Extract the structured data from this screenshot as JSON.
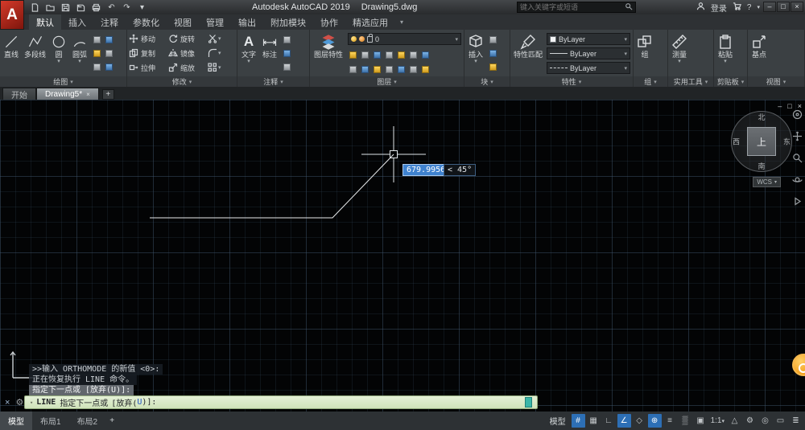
{
  "title_bar": {
    "logo_letter": "A",
    "app_title": "Autodesk AutoCAD 2019",
    "doc_title": "Drawing5.dwg",
    "search_placeholder": "键入关键字或短语",
    "login_label": "登录"
  },
  "ribbon": {
    "tabs": [
      "默认",
      "插入",
      "注释",
      "参数化",
      "视图",
      "管理",
      "输出",
      "附加模块",
      "协作",
      "精选应用"
    ],
    "panels": {
      "draw": {
        "label": "绘图",
        "tools": [
          "直线",
          "多段线",
          "圆",
          "圆弧"
        ]
      },
      "modify": {
        "label": "修改",
        "tools": [
          "移动",
          "旋转",
          "复制",
          "镜像",
          "拉伸",
          "缩放"
        ]
      },
      "annotate": {
        "label": "注释",
        "icon_letter": "A",
        "tools": [
          "文字",
          "标注"
        ]
      },
      "layers": {
        "label": "图层",
        "big": "图层特性",
        "value": "0"
      },
      "block": {
        "label": "块",
        "big": "插入"
      },
      "props": {
        "label": "特性",
        "big": "特性匹配",
        "color": "ByLayer",
        "lineweight": "ByLayer",
        "linetype": "ByLayer"
      },
      "groups": {
        "label": "组",
        "big": "组"
      },
      "utils": {
        "label": "实用工具",
        "big": "测量"
      },
      "clipboard": {
        "label": "剪贴板",
        "big": "粘贴"
      },
      "view": {
        "label": "视图",
        "big": "基点"
      }
    }
  },
  "file_tabs": {
    "start": "开始",
    "drawing": "Drawing5*"
  },
  "canvas": {
    "dyn_length": "679.9956",
    "dyn_angle": "< 45°",
    "viewcube": {
      "north": "北",
      "south": "南",
      "west": "西",
      "east": "东",
      "top": "上",
      "wcs": "WCS"
    },
    "command_history": [
      ">>输入 ORTHOMODE 的新值 <0>:",
      "正在恢复执行 LINE 命令。",
      "指定下一点或 [放弃(U)]:"
    ],
    "prompt": {
      "command": "LINE",
      "text": "指定下一点或",
      "option_pre": "[放弃(",
      "option_key": "U",
      "option_post": ")]:"
    }
  },
  "status_bar": {
    "layout_tabs": [
      "模型",
      "布局1",
      "布局2"
    ],
    "model_button": "模型",
    "scale": "1:1"
  },
  "colors": {
    "accent_blue": "#2d6fb5",
    "command_green": "#d6e8c2",
    "logo_red": "#c02a23",
    "badge_orange": "#ef8d04"
  }
}
